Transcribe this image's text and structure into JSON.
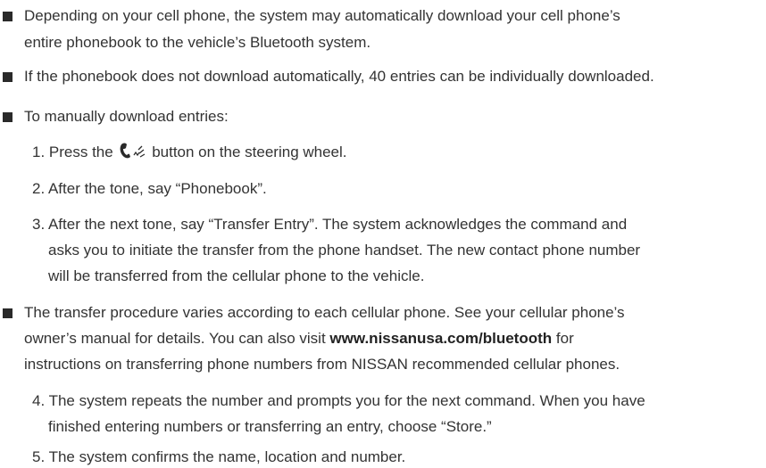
{
  "bullets": {
    "b1_line1": "Depending on your cell phone, the system may automatically download your cell phone’s",
    "b1_line2": "entire phonebook to the vehicle’s Bluetooth system.",
    "b2_line1": "If the phonebook does not download automatically, 40 entries can be individually downloaded.",
    "b3_line1": "To manually download entries:",
    "b4_line1": "The transfer procedure varies according to each cellular phone. See your cellular phone’s",
    "b4_line2": "owner’s manual for details. You can also visit",
    "b4_link": "www.nissanusa.com/bluetooth",
    "b4_line2_end": "for",
    "b4_line3": "instructions on transferring phone numbers from NISSAN recommended cellular phones."
  },
  "steps": {
    "s1_before": "1. Press the",
    "s1_after": "button on the steering wheel.",
    "s2": "2. After the tone, say “Phonebook”.",
    "s3_line1": "3. After the next tone, say “Transfer Entry”. The system acknowledges the command and",
    "s3_line2": "asks you to initiate the transfer from the phone handset. The new contact phone number",
    "s3_line3": "will be transferred from the cellular phone to the vehicle.",
    "s4_line1": "4. The system repeats the number and prompts you for the next command. When you have",
    "s4_line2": "finished entering numbers or transferring an entry, choose “Store.”",
    "s5": "5. The system confirms the name, location and number."
  },
  "icons": {
    "phone_talk": "phone-voice-icon"
  }
}
